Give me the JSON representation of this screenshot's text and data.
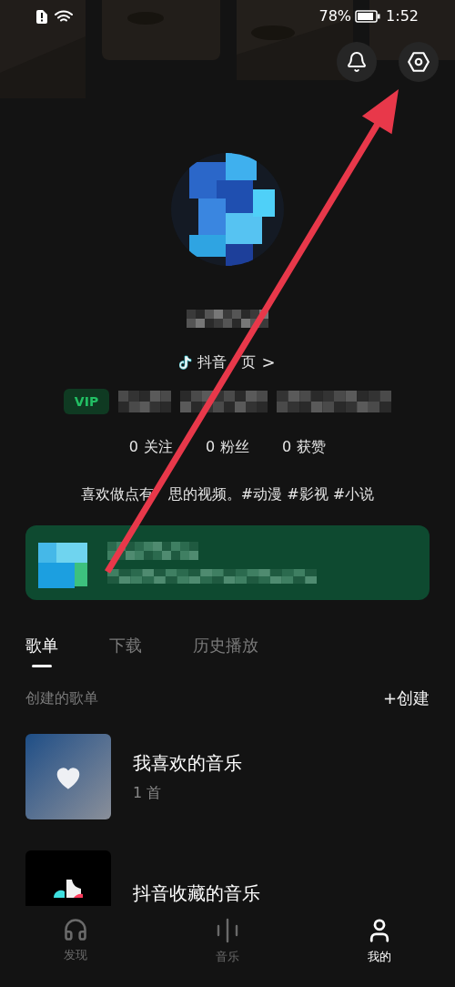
{
  "status_bar": {
    "battery": "78%",
    "time": "1:52"
  },
  "profile": {
    "homepage_link": [
      "抖音",
      "页"
    ],
    "link_chevron": ">",
    "vip_badge": "VIP",
    "stats": [
      {
        "value": "0",
        "label": "关注"
      },
      {
        "value": "0",
        "label": "粉丝"
      },
      {
        "value": "0",
        "label": "获赞"
      }
    ],
    "bio": [
      "喜欢做点有",
      "思的视频。#动漫 #影视 #小说"
    ]
  },
  "tabs": [
    {
      "label": "歌单",
      "selected": true
    },
    {
      "label": "下载",
      "selected": false
    },
    {
      "label": "历史播放",
      "selected": false
    }
  ],
  "section": {
    "title": "创建的歌单",
    "create_button": "+创建"
  },
  "playlists": [
    {
      "kind": "liked",
      "title": "我喜欢的音乐",
      "count": "1 首"
    },
    {
      "kind": "douyin",
      "title": "抖音收藏的音乐"
    }
  ],
  "bottom_nav": [
    {
      "kind": "discover",
      "label": "发现",
      "selected": false
    },
    {
      "kind": "music",
      "label": "音乐",
      "selected": false
    },
    {
      "kind": "me",
      "label": "我的",
      "selected": true
    }
  ]
}
